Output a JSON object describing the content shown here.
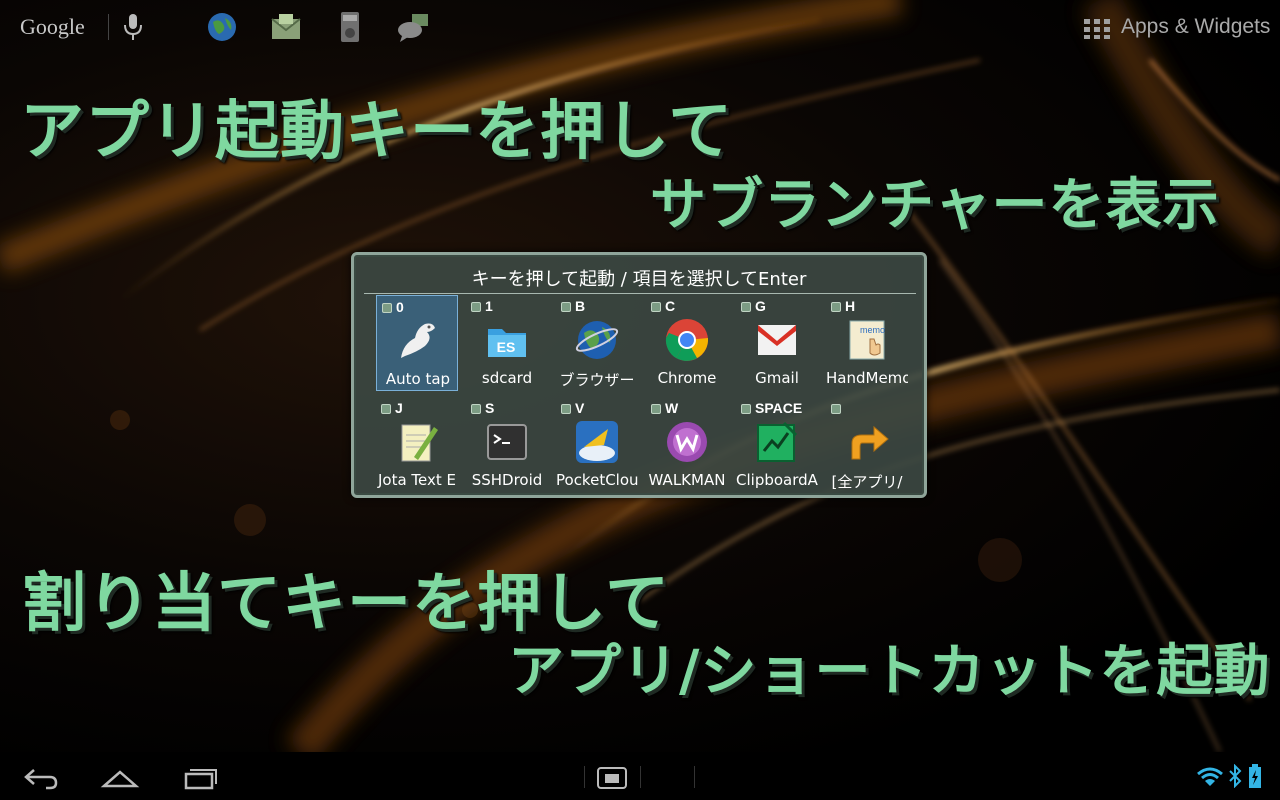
{
  "topbar": {
    "search_label": "Google",
    "apps_label": "Apps & Widgets",
    "icons": [
      "mic-icon",
      "globe-icon",
      "mail-icon",
      "phone-icon",
      "messages-icon"
    ]
  },
  "headlines": {
    "line1": "アプリ起動キーを押して",
    "line2": "サブランチャーを表示",
    "line3": "割り当てキーを押して",
    "line4": "アプリ/ショートカットを起動"
  },
  "dialog": {
    "title": "キーを押して起動 / 項目を選択してEnter",
    "items": [
      {
        "key": "0",
        "label": "Auto tap",
        "icon": "auto-tap-icon",
        "selected": true
      },
      {
        "key": "1",
        "label": "sdcard",
        "icon": "es-file-explorer-icon"
      },
      {
        "key": "B",
        "label": "ブラウザー",
        "icon": "browser-globe-icon"
      },
      {
        "key": "C",
        "label": "Chrome",
        "icon": "chrome-icon"
      },
      {
        "key": "G",
        "label": "Gmail",
        "icon": "gmail-icon"
      },
      {
        "key": "H",
        "label": "HandMemo",
        "icon": "handmemo-icon"
      },
      {
        "key": "J",
        "label": "Jota Text E",
        "icon": "jota-text-icon"
      },
      {
        "key": "S",
        "label": "SSHDroid",
        "icon": "terminal-icon"
      },
      {
        "key": "V",
        "label": "PocketClou",
        "icon": "pocketcloud-icon"
      },
      {
        "key": "W",
        "label": "WALKMAN",
        "icon": "walkman-icon"
      },
      {
        "key": "SPACE",
        "label": "ClipboardA",
        "icon": "clipboard-icon"
      },
      {
        "key": "",
        "label": "[全アプリ/",
        "icon": "all-apps-arrow-icon"
      }
    ]
  },
  "colors": {
    "headline": "#7fd8a0",
    "dialog_bg": "#3c4842",
    "selection": "#3c78aa"
  }
}
